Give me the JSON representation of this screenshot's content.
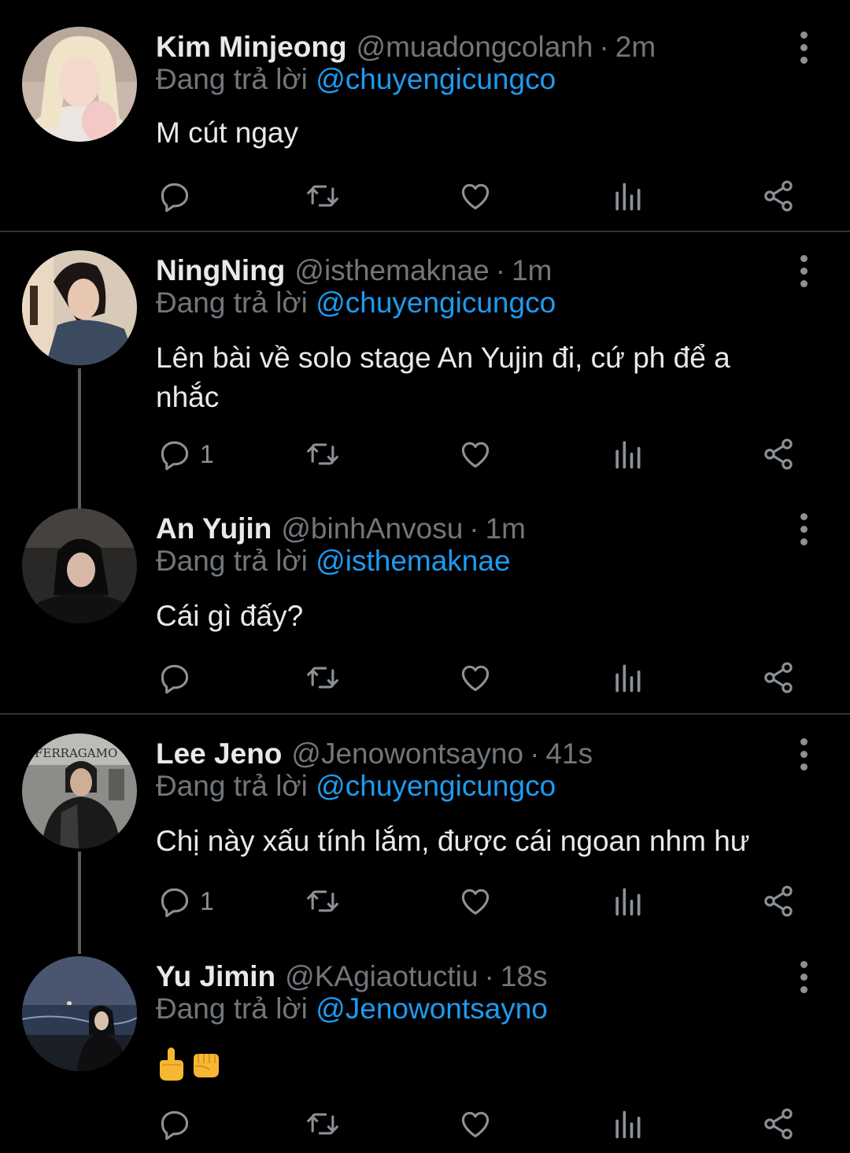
{
  "replying_label": "Đang trả lời",
  "tweets": [
    {
      "name": "Kim Minjeong",
      "handle": "@muadongcolanh",
      "separator": "·",
      "time": "2m",
      "reply_to": "@chuyengicungco",
      "text": "M cút ngay",
      "reply_count": ""
    },
    {
      "name": "NingNing",
      "handle": "@isthemaknae",
      "separator": "·",
      "time": "1m",
      "reply_to": "@chuyengicungco",
      "text": "Lên bài về solo stage An Yujin đi, cứ ph để a nhắc",
      "reply_count": "1"
    },
    {
      "name": "An Yujin",
      "handle": "@binhAnvosu",
      "separator": "·",
      "time": "1m",
      "reply_to": "@isthemaknae",
      "text": "Cái gì đấy?",
      "reply_count": ""
    },
    {
      "name": "Lee Jeno",
      "handle": "@Jenowontsayno",
      "separator": "·",
      "time": "41s",
      "reply_to": "@chuyengicungco",
      "text": "Chị này xấu tính lắm, được cái ngoan nhm hư",
      "reply_count": "1",
      "avatar_sign": "FERRAGAMO"
    },
    {
      "name": "Yu Jimin",
      "handle": "@KAgiaotuctiu",
      "separator": "·",
      "time": "18s",
      "reply_to": "@Jenowontsayno",
      "text": "",
      "emojis": [
        "middle-finger-emoji",
        "fist-emoji"
      ],
      "reply_count": ""
    }
  ],
  "icons": [
    "reply-icon",
    "retweet-icon",
    "like-icon",
    "analytics-icon",
    "share-icon",
    "more-icon"
  ],
  "colors": {
    "background": "#000000",
    "text": "#e7e9ea",
    "muted": "#71767b",
    "link": "#1d9bf0",
    "divider": "#2f3336"
  }
}
